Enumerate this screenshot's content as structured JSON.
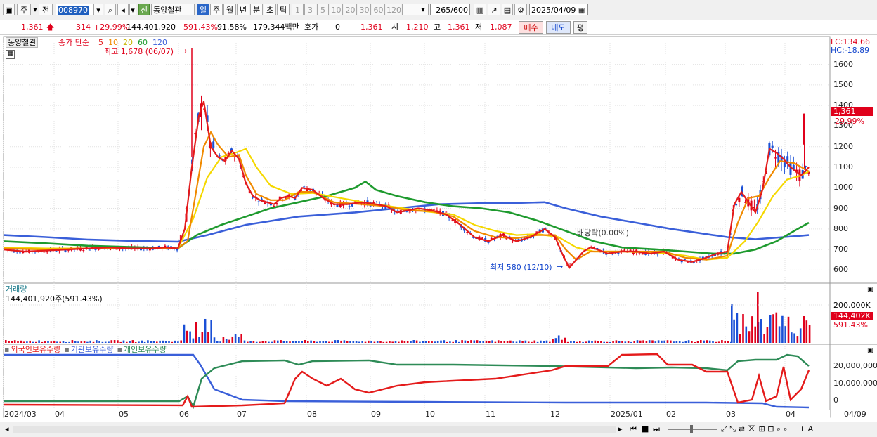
{
  "toolbar": {
    "period_label": "주",
    "prev_label": "전",
    "code_value": "008970",
    "stock_badge": "신",
    "stock_name": "동양철관",
    "periods": [
      "일",
      "주",
      "월",
      "년",
      "분",
      "초",
      "틱"
    ],
    "selected_period": "일",
    "ticks": [
      "1",
      "3",
      "5",
      "10",
      "20",
      "30",
      "60",
      "120"
    ],
    "count_value": "265",
    "count_total": "/600",
    "date_value": "2025/04/09"
  },
  "quote": {
    "price": "1,361",
    "change": "314",
    "change_pct": "+29.99%",
    "volume": "144,401,920",
    "volume_pct": "591.43%",
    "ratio": "91.58%",
    "amount": "179,344백만",
    "hoga_label": "호가",
    "hoga_value": "0",
    "hoga_price": "1,361",
    "open_label": "시",
    "open_value": "1,210",
    "high_label": "고",
    "high_value": "1,361",
    "low_label": "저",
    "low_value": "1,087",
    "buy_label": "매수",
    "sell_label": "매도",
    "eval_label": "평"
  },
  "legend": {
    "stock_name": "동양철관",
    "ma_title": "종가 단순",
    "ma_periods": [
      "5",
      "10",
      "20",
      "60",
      "120"
    ],
    "high_note": "최고 1,678 (06/07)",
    "low_note": "최저 580 (12/10)",
    "dividend_note": "배당락(0.00%)",
    "lc": "LC:134.66",
    "hc": "HC:-18.89",
    "price_tag": "1,361",
    "pct_tag": "29.99%"
  },
  "volume_panel": {
    "title": "거래량",
    "value": "144,401,920주(591.43%)",
    "axis_label": "200,000K",
    "tag": "144,402K",
    "tag_pct": "591.43%"
  },
  "holding_panel": {
    "series": [
      "외국인보유수량",
      "기관보유수량",
      "개인보유수량"
    ],
    "axis": [
      "20,000,000",
      "10,000,000",
      "0"
    ]
  },
  "colors": {
    "up": "#e0001b",
    "down": "#1a4fd6",
    "ma5": "#e41b1b",
    "ma10": "#f08a00",
    "ma20": "#f5d800",
    "ma60": "#1e9a2e",
    "ma120": "#3a5fd9",
    "foreign": "#e41b1b",
    "institution": "#3a5fd9",
    "individual": "#2e8b57"
  },
  "chart_data": {
    "type": "line",
    "price_axis": [
      1600,
      1500,
      1400,
      1300,
      1200,
      1100,
      1000,
      900,
      800,
      700,
      600
    ],
    "month_labels": [
      "2024/03",
      "04",
      "05",
      "06",
      "07",
      "08",
      "09",
      "10",
      "11",
      "12",
      "2025/01",
      "02",
      "03",
      "04",
      "04/09"
    ],
    "series": [
      {
        "name": "5",
        "points": [
          [
            0,
            700
          ],
          [
            30,
            690
          ],
          [
            60,
            695
          ],
          [
            90,
            700
          ],
          [
            120,
            705
          ],
          [
            150,
            710
          ],
          [
            180,
            705
          ],
          [
            210,
            705
          ],
          [
            230,
            710
          ],
          [
            248,
            705
          ],
          [
            258,
            800
          ],
          [
            268,
            1100
          ],
          [
            278,
            1350
          ],
          [
            285,
            1420
          ],
          [
            295,
            1200
          ],
          [
            305,
            1150
          ],
          [
            315,
            1130
          ],
          [
            325,
            1180
          ],
          [
            335,
            1140
          ],
          [
            345,
            1020
          ],
          [
            355,
            960
          ],
          [
            365,
            940
          ],
          [
            375,
            930
          ],
          [
            385,
            920
          ],
          [
            395,
            950
          ],
          [
            405,
            960
          ],
          [
            415,
            950
          ],
          [
            425,
            1000
          ],
          [
            440,
            990
          ],
          [
            455,
            950
          ],
          [
            470,
            920
          ],
          [
            490,
            920
          ],
          [
            510,
            930
          ],
          [
            530,
            920
          ],
          [
            545,
            910
          ],
          [
            560,
            880
          ],
          [
            575,
            890
          ],
          [
            590,
            900
          ],
          [
            610,
            890
          ],
          [
            630,
            870
          ],
          [
            650,
            820
          ],
          [
            670,
            760
          ],
          [
            690,
            740
          ],
          [
            710,
            770
          ],
          [
            730,
            740
          ],
          [
            750,
            760
          ],
          [
            770,
            800
          ],
          [
            785,
            760
          ],
          [
            795,
            680
          ],
          [
            805,
            610
          ],
          [
            815,
            650
          ],
          [
            825,
            690
          ],
          [
            835,
            710
          ],
          [
            845,
            700
          ],
          [
            860,
            680
          ],
          [
            880,
            690
          ],
          [
            900,
            690
          ],
          [
            920,
            680
          ],
          [
            940,
            690
          ],
          [
            960,
            650
          ],
          [
            980,
            640
          ],
          [
            1000,
            660
          ],
          [
            1015,
            680
          ],
          [
            1030,
            690
          ],
          [
            1040,
            920
          ],
          [
            1050,
            980
          ],
          [
            1060,
            930
          ],
          [
            1070,
            880
          ],
          [
            1080,
            990
          ],
          [
            1090,
            1190
          ],
          [
            1100,
            1170
          ],
          [
            1110,
            1140
          ],
          [
            1120,
            1100
          ],
          [
            1135,
            1060
          ],
          [
            1146,
            1100
          ]
        ]
      },
      {
        "name": "10",
        "points": [
          [
            0,
            705
          ],
          [
            60,
            700
          ],
          [
            120,
            705
          ],
          [
            180,
            705
          ],
          [
            248,
            705
          ],
          [
            262,
            740
          ],
          [
            275,
            1000
          ],
          [
            285,
            1200
          ],
          [
            295,
            1270
          ],
          [
            305,
            1210
          ],
          [
            320,
            1150
          ],
          [
            335,
            1160
          ],
          [
            345,
            1060
          ],
          [
            360,
            970
          ],
          [
            380,
            940
          ],
          [
            400,
            940
          ],
          [
            420,
            980
          ],
          [
            440,
            980
          ],
          [
            470,
            930
          ],
          [
            510,
            920
          ],
          [
            545,
            910
          ],
          [
            575,
            890
          ],
          [
            610,
            885
          ],
          [
            640,
            860
          ],
          [
            670,
            790
          ],
          [
            700,
            760
          ],
          [
            730,
            755
          ],
          [
            760,
            770
          ],
          [
            785,
            770
          ],
          [
            800,
            700
          ],
          [
            815,
            650
          ],
          [
            835,
            690
          ],
          [
            860,
            690
          ],
          [
            900,
            690
          ],
          [
            940,
            690
          ],
          [
            970,
            660
          ],
          [
            1000,
            650
          ],
          [
            1030,
            670
          ],
          [
            1045,
            830
          ],
          [
            1060,
            950
          ],
          [
            1075,
            960
          ],
          [
            1090,
            1050
          ],
          [
            1105,
            1130
          ],
          [
            1125,
            1120
          ],
          [
            1146,
            1080
          ]
        ]
      },
      {
        "name": "20",
        "points": [
          [
            0,
            710
          ],
          [
            60,
            705
          ],
          [
            120,
            705
          ],
          [
            180,
            705
          ],
          [
            248,
            705
          ],
          [
            270,
            850
          ],
          [
            290,
            1050
          ],
          [
            310,
            1150
          ],
          [
            330,
            1170
          ],
          [
            345,
            1190
          ],
          [
            360,
            1100
          ],
          [
            380,
            1010
          ],
          [
            410,
            970
          ],
          [
            440,
            975
          ],
          [
            480,
            950
          ],
          [
            520,
            925
          ],
          [
            560,
            905
          ],
          [
            600,
            885
          ],
          [
            640,
            870
          ],
          [
            670,
            820
          ],
          [
            700,
            790
          ],
          [
            730,
            770
          ],
          [
            760,
            775
          ],
          [
            790,
            760
          ],
          [
            815,
            710
          ],
          [
            840,
            690
          ],
          [
            880,
            690
          ],
          [
            930,
            685
          ],
          [
            970,
            670
          ],
          [
            1000,
            650
          ],
          [
            1030,
            660
          ],
          [
            1055,
            740
          ],
          [
            1075,
            840
          ],
          [
            1095,
            960
          ],
          [
            1115,
            1040
          ],
          [
            1135,
            1060
          ],
          [
            1146,
            1080
          ]
        ]
      },
      {
        "name": "60",
        "points": [
          [
            0,
            740
          ],
          [
            60,
            730
          ],
          [
            120,
            718
          ],
          [
            180,
            712
          ],
          [
            248,
            705
          ],
          [
            275,
            770
          ],
          [
            310,
            820
          ],
          [
            345,
            860
          ],
          [
            380,
            900
          ],
          [
            420,
            930
          ],
          [
            460,
            960
          ],
          [
            500,
            1000
          ],
          [
            515,
            1030
          ],
          [
            530,
            990
          ],
          [
            560,
            960
          ],
          [
            600,
            930
          ],
          [
            640,
            910
          ],
          [
            680,
            900
          ],
          [
            720,
            880
          ],
          [
            760,
            840
          ],
          [
            800,
            790
          ],
          [
            840,
            740
          ],
          [
            880,
            710
          ],
          [
            930,
            700
          ],
          [
            970,
            690
          ],
          [
            1010,
            680
          ],
          [
            1040,
            680
          ],
          [
            1070,
            700
          ],
          [
            1100,
            740
          ],
          [
            1125,
            790
          ],
          [
            1146,
            830
          ]
        ]
      },
      {
        "name": "120",
        "points": [
          [
            0,
            770
          ],
          [
            60,
            760
          ],
          [
            120,
            748
          ],
          [
            180,
            742
          ],
          [
            248,
            738
          ],
          [
            290,
            770
          ],
          [
            345,
            820
          ],
          [
            420,
            860
          ],
          [
            500,
            880
          ],
          [
            560,
            900
          ],
          [
            620,
            920
          ],
          [
            680,
            925
          ],
          [
            720,
            925
          ],
          [
            770,
            930
          ],
          [
            800,
            900
          ],
          [
            850,
            860
          ],
          [
            900,
            830
          ],
          [
            950,
            800
          ],
          [
            990,
            780
          ],
          [
            1030,
            760
          ],
          [
            1070,
            750
          ],
          [
            1110,
            760
          ],
          [
            1146,
            770
          ]
        ]
      }
    ],
    "high": {
      "x": 268,
      "price": 1678,
      "label": "최고 1,678 (06/07)"
    },
    "low": {
      "x": 805,
      "price": 580,
      "label": "최저 580 (12/10)"
    }
  }
}
